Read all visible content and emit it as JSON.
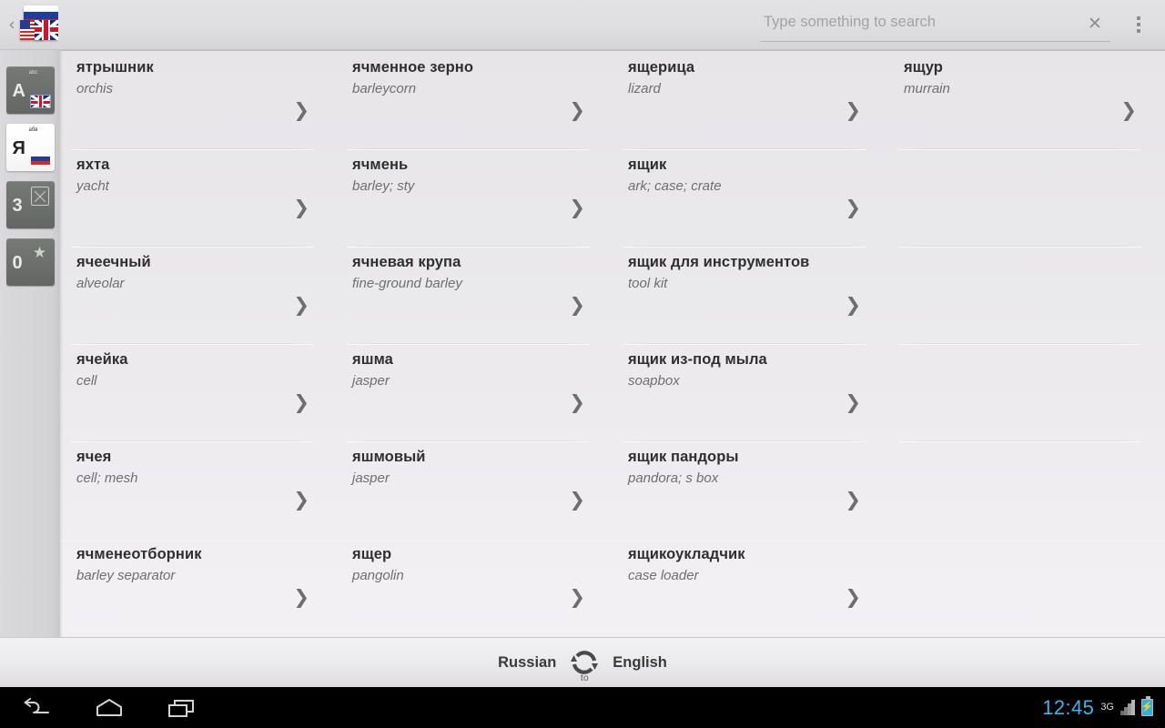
{
  "header": {
    "back_glyph": "‹",
    "logo_name": "dictionary-app-logo",
    "search": {
      "placeholder": "Type something to search",
      "value": "",
      "clear_glyph": "✕"
    },
    "overflow_label": "⋮"
  },
  "sidebar": {
    "tabs": [
      {
        "letter": "A",
        "abc": "abc",
        "flag": "uk",
        "glyph": "",
        "active": false,
        "name": "sidebar-tab-english"
      },
      {
        "letter": "Я",
        "abc": "абв",
        "flag": "ru",
        "glyph": "",
        "active": true,
        "name": "sidebar-tab-russian"
      },
      {
        "letter": "3",
        "abc": "",
        "flag": "",
        "glyph": "history",
        "active": false,
        "name": "sidebar-tab-history"
      },
      {
        "letter": "0",
        "abc": "",
        "flag": "",
        "glyph": "★",
        "active": false,
        "name": "sidebar-tab-favorites"
      }
    ]
  },
  "columns": [
    {
      "entries": [
        {
          "term": "ятрышник",
          "translation": "orchis",
          "chevron": "❯"
        },
        {
          "term": "яхта",
          "translation": "yacht",
          "chevron": "❯"
        },
        {
          "term": "ячеечный",
          "translation": "alveolar",
          "chevron": "❯"
        },
        {
          "term": "ячейка",
          "translation": "cell",
          "chevron": "❯"
        },
        {
          "term": "ячея",
          "translation": "cell; mesh",
          "chevron": "❯"
        },
        {
          "term": "ячменеотборник",
          "translation": "barley separator",
          "chevron": "❯"
        }
      ]
    },
    {
      "entries": [
        {
          "term": "ячменное зерно",
          "translation": "barleycorn",
          "chevron": "❯"
        },
        {
          "term": "ячмень",
          "translation": "barley; sty",
          "chevron": "❯"
        },
        {
          "term": "ячневая крупа",
          "translation": "fine-ground barley",
          "chevron": "❯"
        },
        {
          "term": "яшма",
          "translation": "jasper",
          "chevron": "❯"
        },
        {
          "term": "яшмовый",
          "translation": "jasper",
          "chevron": "❯"
        },
        {
          "term": "ящер",
          "translation": "pangolin",
          "chevron": "❯"
        }
      ]
    },
    {
      "entries": [
        {
          "term": "ящерица",
          "translation": "lizard",
          "chevron": "❯"
        },
        {
          "term": "ящик",
          "translation": "ark; case; crate",
          "chevron": "❯"
        },
        {
          "term": "ящик для инструментов",
          "translation": "tool kit",
          "chevron": "❯"
        },
        {
          "term": "ящик из-под мыла",
          "translation": "soapbox",
          "chevron": "❯"
        },
        {
          "term": "ящик пандоры",
          "translation": "pandora; s box",
          "chevron": "❯"
        },
        {
          "term": "ящикоукладчик",
          "translation": "case loader",
          "chevron": "❯"
        }
      ]
    },
    {
      "entries": [
        {
          "term": "ящур",
          "translation": "murrain",
          "chevron": "❯"
        },
        {
          "term": "",
          "translation": "",
          "chevron": ""
        },
        {
          "term": "",
          "translation": "",
          "chevron": ""
        },
        {
          "term": "",
          "translation": "",
          "chevron": ""
        },
        {
          "term": "",
          "translation": "",
          "chevron": ""
        },
        {
          "term": "",
          "translation": "",
          "chevron": ""
        }
      ]
    }
  ],
  "langbar": {
    "source": "Russian",
    "target": "English",
    "swap_label": "to"
  },
  "navbar": {
    "back_name": "back-button",
    "home_name": "home-button",
    "recents_name": "recent-apps-button",
    "clock": "12:45",
    "network": "3G",
    "battery_glyph": "⚡"
  },
  "colors": {
    "accent": "#33b5e5",
    "header_bg": "#dedddf",
    "content_bg": "#e9e8ea",
    "tab_inactive": "#6c6f6c"
  }
}
